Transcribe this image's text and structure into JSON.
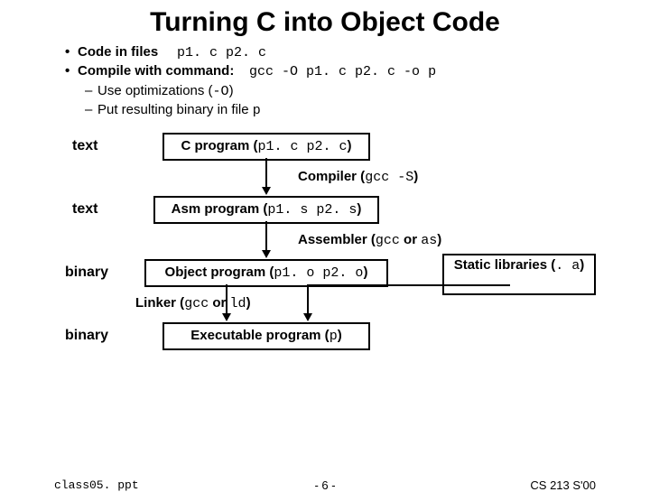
{
  "title": "Turning C into Object Code",
  "bullets": {
    "b1a_pre": "Code in files ",
    "b1a_code": "p1. c p2. c",
    "b1b_pre": "Compile with command: ",
    "b1b_code": "gcc -O p1. c p2. c -o p",
    "b2a_pre": "Use optimizations (",
    "b2a_code": "-O",
    "b2a_post": ")",
    "b2b_pre": "Put resulting binary in file ",
    "b2b_code": "p"
  },
  "rowlabels": {
    "text1": "text",
    "text2": "text",
    "binary1": "binary",
    "binary2": "binary"
  },
  "boxes": {
    "cprog_pre": "C program (",
    "cprog_code": "p1. c p2. c",
    "cprog_post": ")",
    "asm_pre": "Asm program (",
    "asm_code": "p1. s p2. s",
    "asm_post": ")",
    "obj_pre": "Object program (",
    "obj_code": "p1. o p2. o",
    "obj_post": ")",
    "libs_pre": "Static libraries (",
    "libs_code": ". a",
    "libs_post": ")",
    "exe_pre": "Executable program (",
    "exe_code": "p",
    "exe_post": ")"
  },
  "edges": {
    "compiler_pre": "Compiler (",
    "compiler_code": "gcc -S",
    "compiler_post": ")",
    "assembler_pre": "Assembler (",
    "assembler_code": "gcc",
    "assembler_mid": " or ",
    "assembler_code2": "as",
    "assembler_post": ")",
    "linker_pre": "Linker (",
    "linker_code": "gcc",
    "linker_mid": " or ",
    "linker_code2": "ld",
    "linker_post": ")"
  },
  "footer": {
    "left": "class05. ppt",
    "center": "- 6 -",
    "right": "CS 213 S'00"
  }
}
